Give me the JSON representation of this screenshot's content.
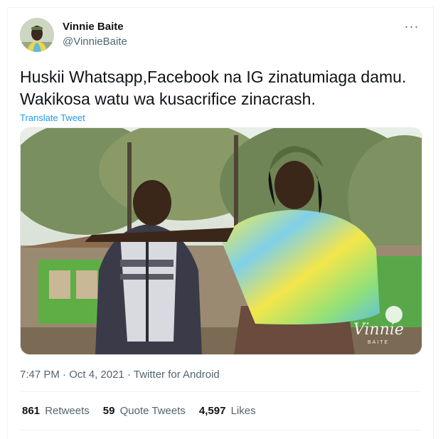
{
  "author": {
    "name": "Vinnie Baite",
    "handle": "@VinnieBaite"
  },
  "more_icon": "···",
  "tweet": {
    "lines": [
      "Huskii Whatsapp,Facebook na IG zinatumiaga damu.",
      "Wakikosa watu wa kusacrifice zinacrash."
    ],
    "translate_label": "Translate Tweet"
  },
  "media": {
    "watermark_text": "Vinnie",
    "watermark_sub": "BAITE"
  },
  "meta": {
    "time": "7:47 PM",
    "date": "Oct 4, 2021",
    "source": "Twitter for Android",
    "separator": "·"
  },
  "stats": {
    "retweets_count": "861",
    "retweets_label": "Retweets",
    "quotes_count": "59",
    "quotes_label": "Quote Tweets",
    "likes_count": "4,597",
    "likes_label": "Likes"
  },
  "colors": {
    "link": "#1d9bf0",
    "secondary_text": "#536471",
    "primary_text": "#0f1419"
  }
}
